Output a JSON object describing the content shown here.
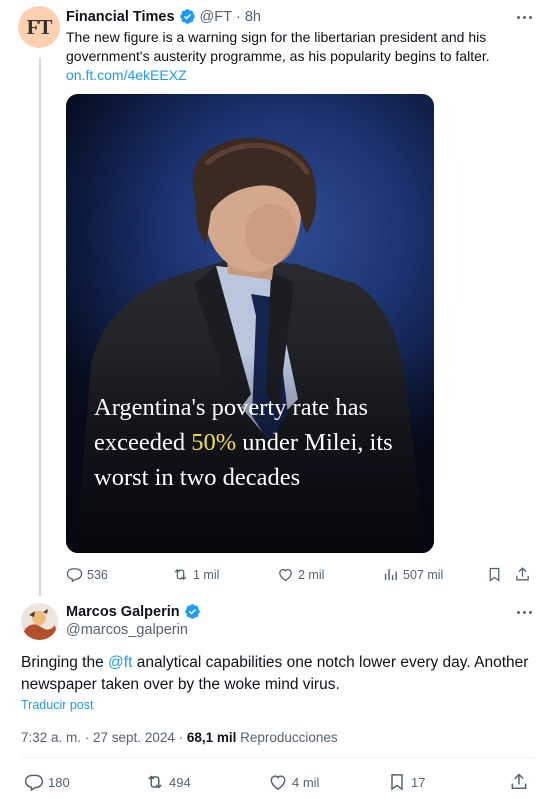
{
  "parent_tweet": {
    "author_name": "Financial Times",
    "handle": "@FT",
    "separator": "·",
    "time": "8h",
    "avatar_text": "FT",
    "text": "The new figure is a warning sign for the libertarian president and his government's austerity programme, as his popularity begins to falter.",
    "link": "on.ft.com/4ekEEXZ",
    "media": {
      "headline_part1": "Argentina's poverty rate has exceeded ",
      "headline_highlight": "50%",
      "headline_part2": " under Milei, its worst in two decades",
      "highlight_color": "#f5dd4b"
    },
    "actions": {
      "replies": "536",
      "reposts": "1 mil",
      "likes": "2 mil",
      "views": "507 mil"
    }
  },
  "main_tweet": {
    "author_name": "Marcos Galperin",
    "handle": "@marcos_galperin",
    "text_before_mention": "Bringing the ",
    "mention": "@ft",
    "text_after_mention": " analytical capabilities one notch lower every day. Another newspaper taken over by the woke mind virus.",
    "translate_label": "Traducir post",
    "timestamp": "7:32 a. m. · 27 sept. 2024 · ",
    "views_count": "68,1 mil",
    "views_label": " Reproducciones",
    "actions": {
      "replies": "180",
      "reposts": "494",
      "likes": "4 mil",
      "bookmarks": "17"
    }
  },
  "colors": {
    "accent": "#1d9bf0",
    "muted": "#536471",
    "text": "#0f1419"
  },
  "icons": [
    "verified-badge-icon",
    "more-icon",
    "reply-icon",
    "repost-icon",
    "like-icon",
    "views-icon",
    "bookmark-icon",
    "share-icon"
  ]
}
